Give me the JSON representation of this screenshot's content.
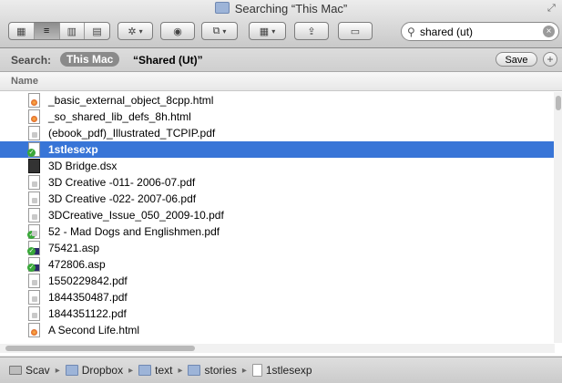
{
  "window": {
    "title": "Searching “This Mac”"
  },
  "toolbar": {
    "view_icons": [
      "icon-view-icon",
      "list-view-icon",
      "column-view-icon",
      "coverflow-view-icon"
    ],
    "action_glyph": "✲",
    "quicklook_glyph": "◉",
    "dropbox_glyph": "⧉",
    "arrange_glyph": "▦",
    "share_glyph": "⇪",
    "tags_glyph": "▭",
    "caret": "▾"
  },
  "search": {
    "value": "shared (ut)",
    "placeholder": "Search",
    "clear_glyph": "×"
  },
  "scope": {
    "label": "Search:",
    "selected": "This Mac",
    "term": "“Shared (Ut)”",
    "save_label": "Save",
    "add_glyph": "+"
  },
  "list": {
    "column_header": "Name",
    "rows": [
      {
        "name": "_basic_external_object_8cpp.html",
        "icon": "html"
      },
      {
        "name": "_so_shared_lib_defs_8h.html",
        "icon": "html"
      },
      {
        "name": "(ebook_pdf)_Illustrated_TCPIP.pdf",
        "icon": "pdf"
      },
      {
        "name": "1stlesexp",
        "icon": "file-check",
        "selected": true
      },
      {
        "name": "3D Bridge.dsx",
        "icon": "dsx"
      },
      {
        "name": "3D Creative -011- 2006-07.pdf",
        "icon": "pdf"
      },
      {
        "name": "3D Creative -022- 2007-06.pdf",
        "icon": "pdf"
      },
      {
        "name": "3DCreative_Issue_050_2009-10.pdf",
        "icon": "pdf"
      },
      {
        "name": "52 - Mad Dogs and Englishmen.pdf",
        "icon": "pdf-check"
      },
      {
        "name": "75421.asp",
        "icon": "asp-check"
      },
      {
        "name": "472806.asp",
        "icon": "asp-check"
      },
      {
        "name": "1550229842.pdf",
        "icon": "pdf"
      },
      {
        "name": "1844350487.pdf",
        "icon": "pdf"
      },
      {
        "name": "1844351122.pdf",
        "icon": "pdf"
      },
      {
        "name": "A Second Life.html",
        "icon": "html"
      }
    ]
  },
  "pathbar": {
    "crumbs": [
      {
        "label": "Scav",
        "icon": "drive"
      },
      {
        "label": "Dropbox",
        "icon": "folder"
      },
      {
        "label": "text",
        "icon": "folder"
      },
      {
        "label": "stories",
        "icon": "folder"
      },
      {
        "label": "1stlesexp",
        "icon": "file"
      }
    ],
    "separator": "▸"
  }
}
